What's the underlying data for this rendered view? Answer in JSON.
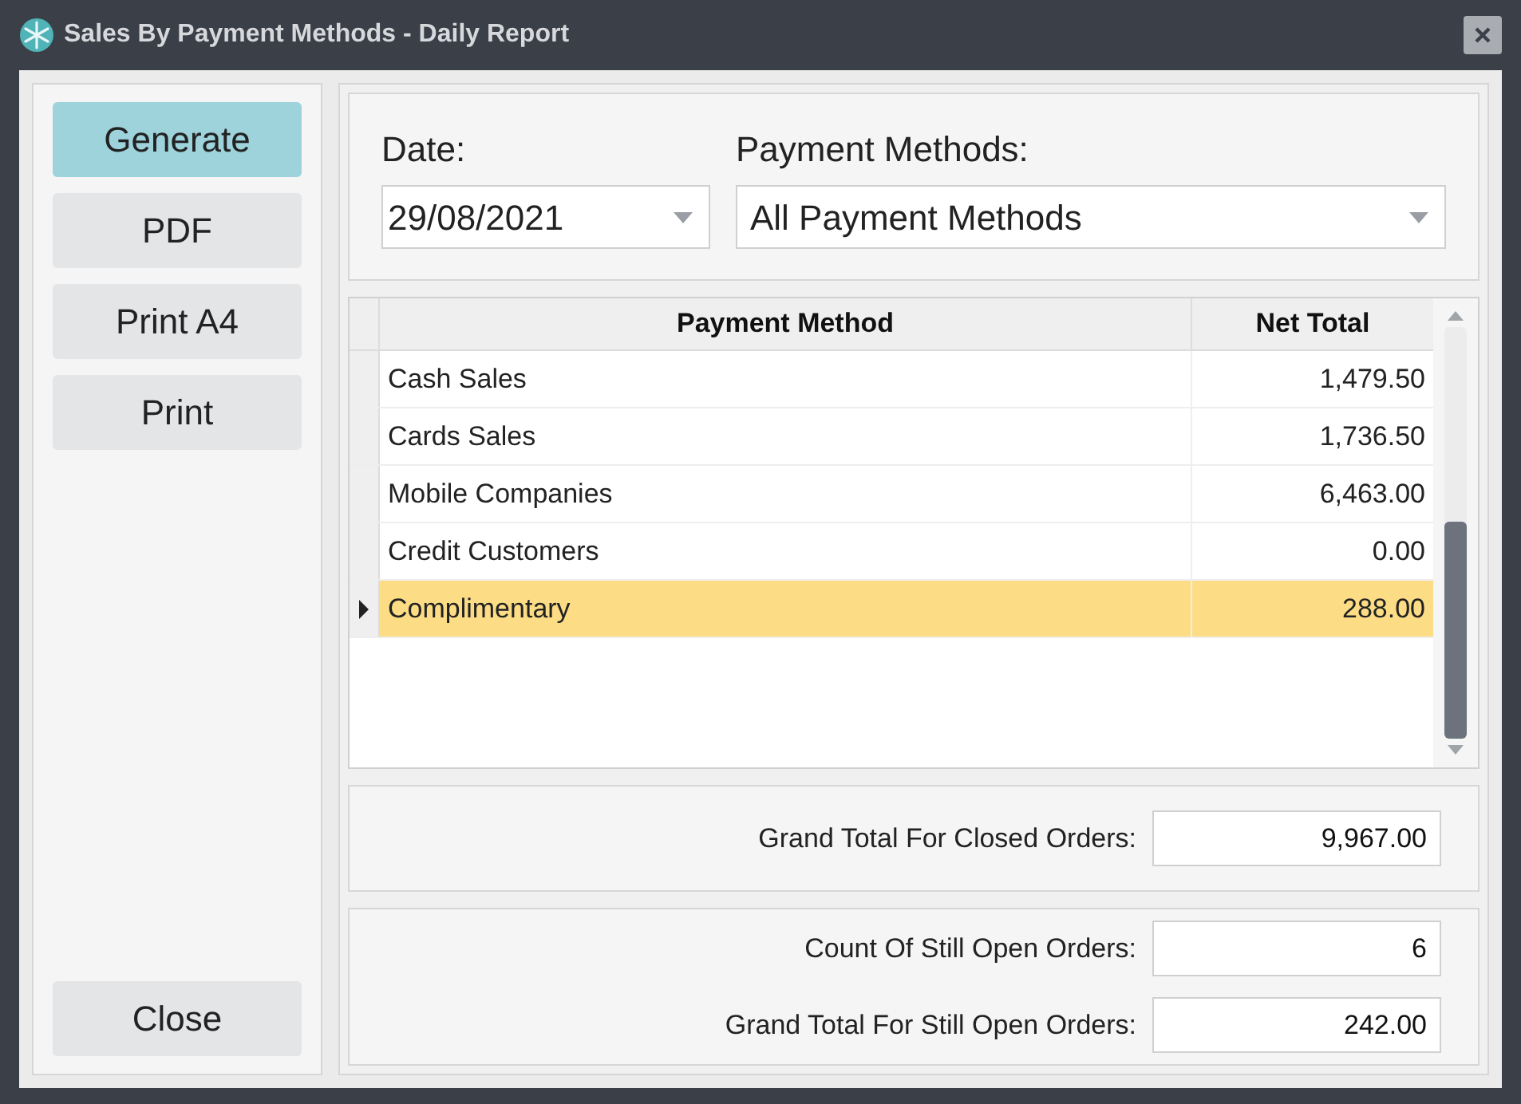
{
  "window": {
    "title": "Sales By Payment Methods - Daily Report"
  },
  "side_buttons": [
    {
      "label": "Generate",
      "selected": true
    },
    {
      "label": "PDF",
      "selected": false
    },
    {
      "label": "Print A4",
      "selected": false
    },
    {
      "label": "Print",
      "selected": false
    }
  ],
  "close_button": "Close",
  "filters": {
    "date_label": "Date:",
    "date_value": "29/08/2021",
    "method_label": "Payment Methods:",
    "method_value": "All Payment Methods"
  },
  "table": {
    "columns": [
      "Payment Method",
      "Net Total"
    ],
    "rows": [
      {
        "cells": [
          "Cash Sales",
          "1,479.50"
        ],
        "selected": false
      },
      {
        "cells": [
          "Cards Sales",
          "1,736.50"
        ],
        "selected": false
      },
      {
        "cells": [
          "Mobile Companies",
          "6,463.00"
        ],
        "selected": false
      },
      {
        "cells": [
          "Credit Customers",
          "0.00"
        ],
        "selected": false
      },
      {
        "cells": [
          "Complimentary",
          "288.00"
        ],
        "selected": true
      }
    ]
  },
  "closed_totals": [
    {
      "label": "Grand Total For Closed Orders:",
      "value": "9,967.00"
    }
  ],
  "open_totals": [
    {
      "label": "Count Of Still Open Orders:",
      "value": "6"
    },
    {
      "label": "Grand Total For Still Open Orders:",
      "value": "242.00"
    }
  ]
}
